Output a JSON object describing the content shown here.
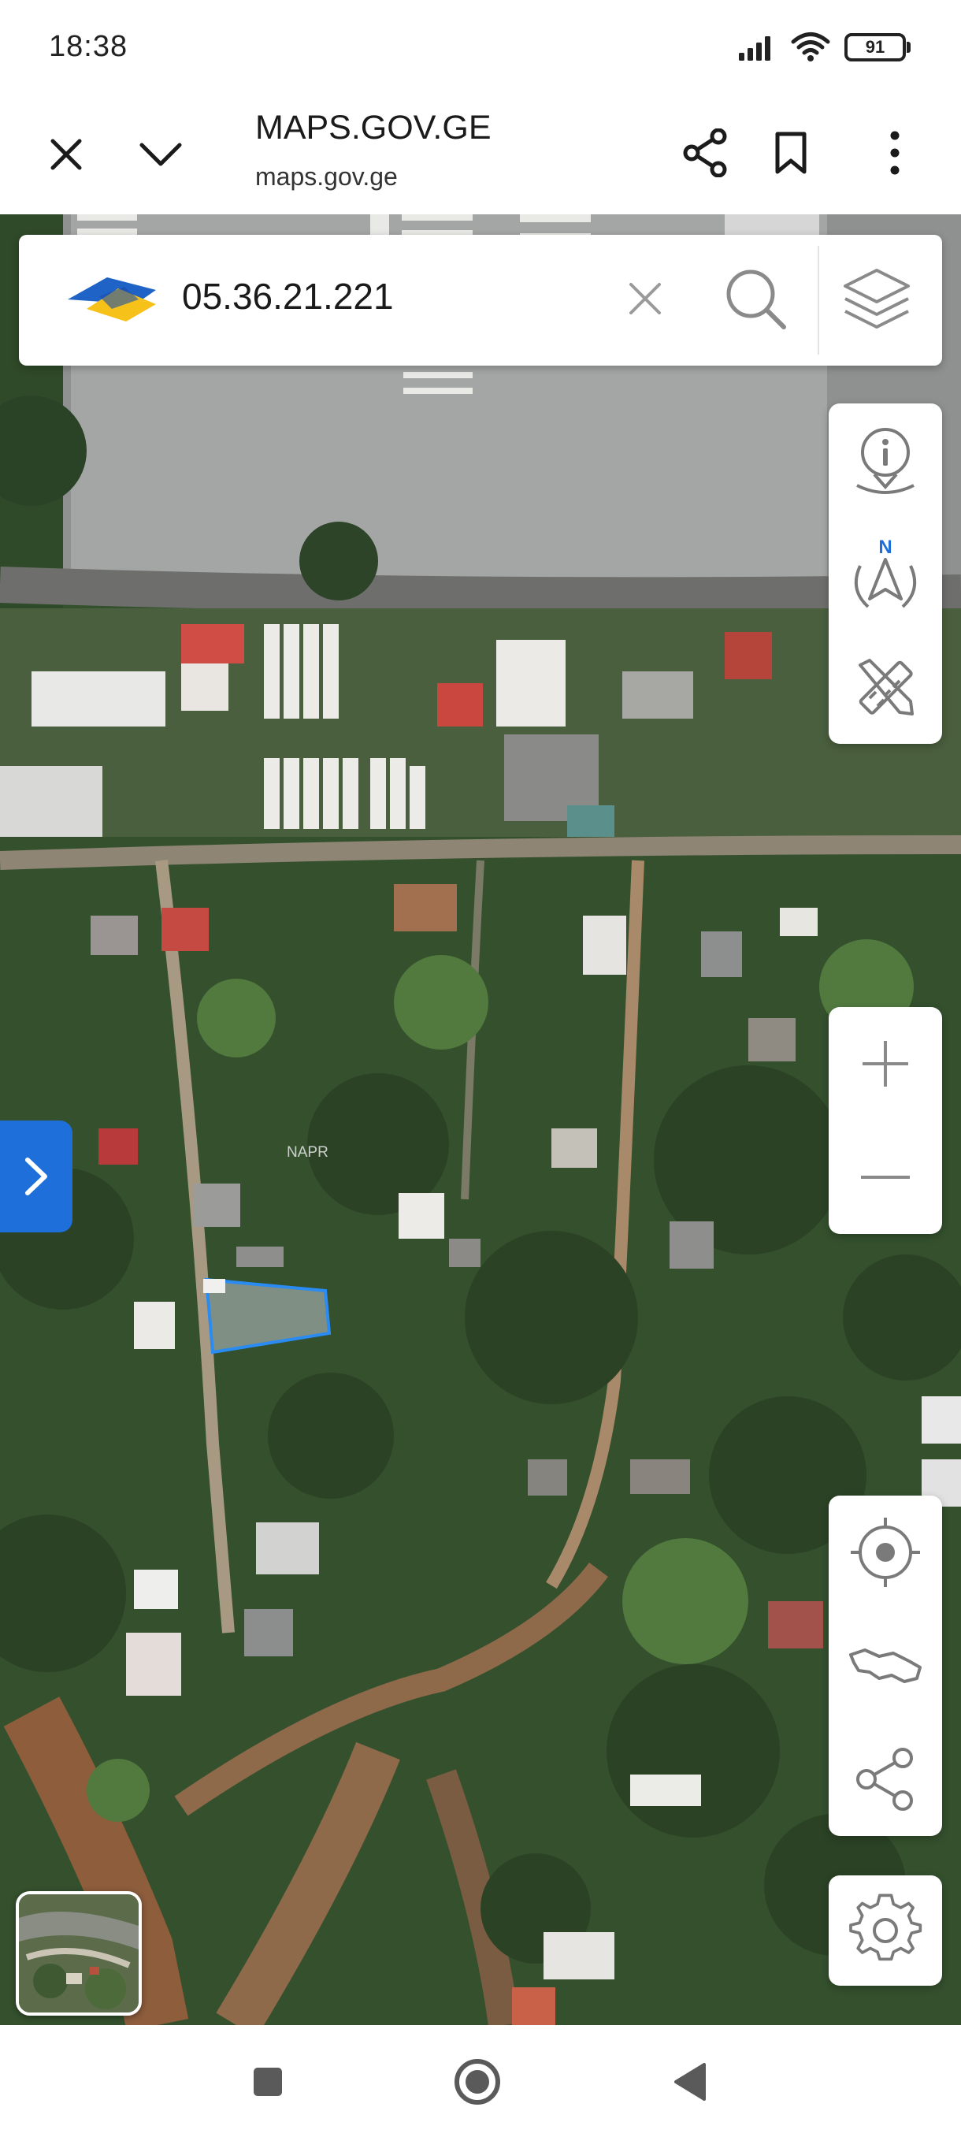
{
  "status_bar": {
    "time": "18:38",
    "battery": "91",
    "icons": [
      "signal-icon",
      "wifi-icon",
      "battery-icon"
    ]
  },
  "browser": {
    "title": "MAPS.GOV.GE",
    "url": "maps.gov.ge",
    "icons": [
      "close-icon",
      "chevron-down-icon",
      "share-icon",
      "bookmark-icon",
      "more-vert-icon"
    ]
  },
  "search": {
    "value": "05.36.21.221",
    "icons": [
      "logo",
      "clear-icon",
      "search-icon",
      "layers-icon"
    ]
  },
  "map": {
    "watermark": "NAPR",
    "tools_top": [
      "location-info-icon",
      "compass-north-icon",
      "measure-tools-icon"
    ],
    "compass_letter": "N",
    "zoom": [
      "zoom-in-icon",
      "zoom-out-icon"
    ],
    "tools_bottom": [
      "my-location-icon",
      "georgia-map-icon",
      "share-icon"
    ],
    "settings": "settings-icon",
    "side_panel": "chevron-right-icon",
    "colors": {
      "accent": "#1e6fd9",
      "parcel_outline": "#2a8bf2",
      "icon_gray": "#7a7a7a"
    }
  },
  "nav_bar": {
    "buttons": [
      "recents-square-icon",
      "home-circle-icon",
      "back-triangle-icon"
    ]
  }
}
